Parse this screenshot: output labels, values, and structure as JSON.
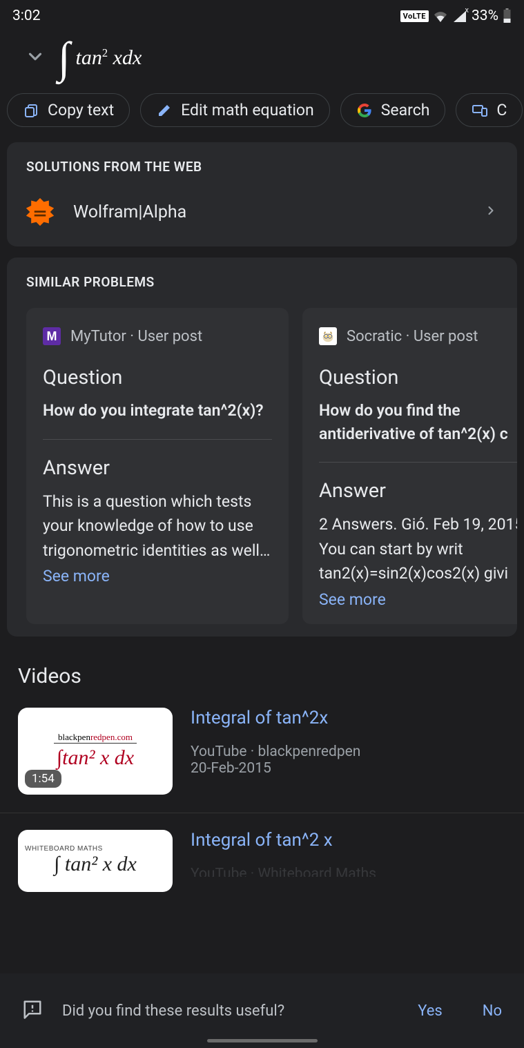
{
  "status": {
    "time": "3:02",
    "volte": "VoLTE",
    "battery": "33%"
  },
  "equation_display": "∫ tan² x dx",
  "chips": {
    "copy": "Copy text",
    "edit": "Edit math equation",
    "search": "Search",
    "next_partial": "C"
  },
  "solutions_panel": {
    "title": "SOLUTIONS FROM THE WEB",
    "wolfram": "Wolfram|Alpha"
  },
  "similar_panel": {
    "title": "SIMILAR PROBLEMS",
    "cards": [
      {
        "source": "MyTutor · User post",
        "q_label": "Question",
        "q_text": "How do you integrate tan^2(x)?",
        "a_label": "Answer",
        "a_text": "This is a question which tests your knowledge of how to use trigonometric identities as well…",
        "see_more": "See more"
      },
      {
        "source": "Socratic · User post",
        "q_label": "Question",
        "q_text": "How do you find the antiderivative of tan^2(x) c",
        "a_label": "Answer",
        "a_text": "2 Answers. Gió. Feb 19, 2015. You can start by writ tan2(x)=sin2(x)cos2(x) givi",
        "see_more": "See more"
      }
    ]
  },
  "videos": {
    "title": "Videos",
    "items": [
      {
        "title": "Integral of tan^2x",
        "source": "YouTube · blackpenredpen",
        "date": "20-Feb-2015",
        "duration": "1:54",
        "thumb_label1_black": "blackpen",
        "thumb_label1_red": "redpen.com",
        "thumb_eq": "∫tan² x dx"
      },
      {
        "title": "Integral of tan^2 x",
        "source_partial": "YouTube · Whiteboard Maths",
        "thumb_top": "WHITEBOARD MATHS",
        "thumb_eq": "∫ tan² x dx"
      }
    ]
  },
  "feedback": {
    "text": "Did you find these results useful?",
    "yes": "Yes",
    "no": "No"
  }
}
